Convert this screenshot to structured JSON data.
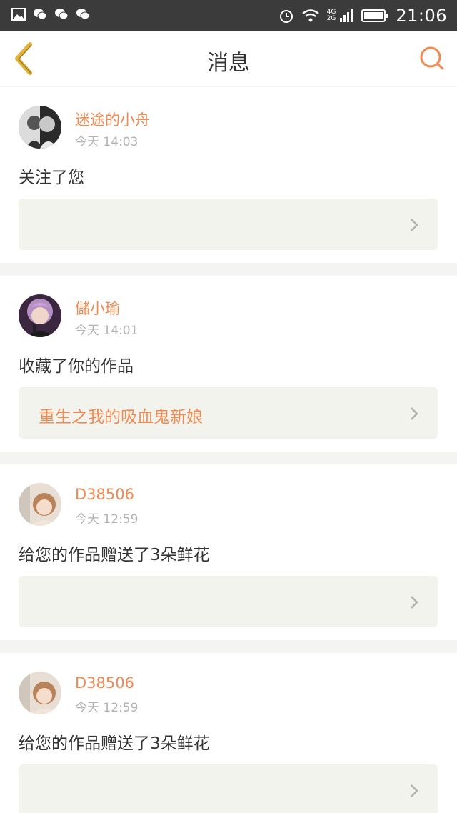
{
  "status_bar": {
    "time": "21:06",
    "network_top": "4G",
    "network_bottom": "2G",
    "icons": [
      "image-icon",
      "wechat-icon",
      "wechat-icon",
      "wechat-icon",
      "alarm-icon",
      "wifi-icon",
      "signal-icon",
      "battery-icon"
    ]
  },
  "header": {
    "title": "消息",
    "back_icon": "chevron-left-icon",
    "search_icon": "search-icon"
  },
  "colors": {
    "accent": "#ef8a52",
    "back_icon": "#e2b33a",
    "card_box": "#f3f3ee",
    "background": "#f4f4f2"
  },
  "messages": [
    {
      "username": "迷途的小舟",
      "time": "今天 14:03",
      "action": "关注了您",
      "work_title": "",
      "avatar": "avatar-1"
    },
    {
      "username": "儲小瑜",
      "time": "今天 14:01",
      "action": "收藏了你的作品",
      "work_title": "重生之我的吸血鬼新娘",
      "avatar": "avatar-2"
    },
    {
      "username": "D38506",
      "time": "今天 12:59",
      "action": "给您的作品赠送了3朵鲜花",
      "work_title": "",
      "avatar": "avatar-3"
    },
    {
      "username": "D38506",
      "time": "今天 12:59",
      "action": "给您的作品赠送了3朵鲜花",
      "work_title": "",
      "avatar": "avatar-3"
    }
  ]
}
